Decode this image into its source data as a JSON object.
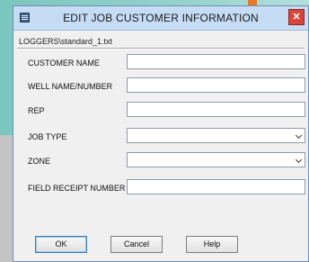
{
  "window": {
    "title": "EDIT JOB CUSTOMER INFORMATION",
    "close_glyph": "✕"
  },
  "file_path": "LOGGERS\\standard_1.txt",
  "fields": [
    {
      "label": "CUSTOMER NAME",
      "value": ""
    },
    {
      "label": "WELL NAME/NUMBER",
      "value": ""
    },
    {
      "label": "REP",
      "value": ""
    },
    {
      "label": "JOB TYPE",
      "value": ""
    },
    {
      "label": "ZONE",
      "value": ""
    },
    {
      "label": "FIELD RECEIPT NUMBER",
      "value": ""
    }
  ],
  "buttons": {
    "ok": "OK",
    "cancel": "Cancel",
    "help": "Help"
  },
  "icons": {
    "app": "app-window-icon",
    "close": "close-icon",
    "dropdown": "chevron-down-icon"
  },
  "colors": {
    "titlebar": "#c6dcf5",
    "close": "#d9453b",
    "window_bg": "#f0f0f0",
    "desktop_accent": "#e8792a"
  }
}
